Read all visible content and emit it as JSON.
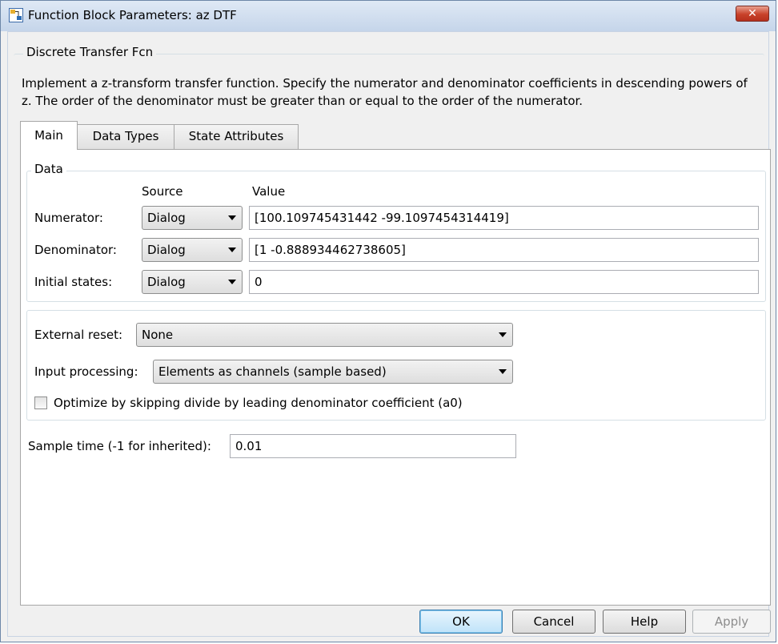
{
  "window": {
    "title": "Function Block Parameters: az DTF",
    "close_glyph": "✕"
  },
  "block": {
    "group_title": "Discrete Transfer Fcn",
    "description": "Implement a z-transform transfer function. Specify the numerator and denominator coefficients in descending powers of z. The order of the denominator must be greater than or equal to the order of the numerator."
  },
  "tabs": [
    {
      "label": "Main",
      "active": true
    },
    {
      "label": "Data Types",
      "active": false
    },
    {
      "label": "State Attributes",
      "active": false
    }
  ],
  "data_group": {
    "title": "Data",
    "source_header": "Source",
    "value_header": "Value",
    "rows": [
      {
        "label": "Numerator:",
        "source": "Dialog",
        "value": "[100.109745431442 -99.1097454314419]"
      },
      {
        "label": "Denominator:",
        "source": "Dialog",
        "value": "[1 -0.888934462738605]"
      },
      {
        "label": "Initial states:",
        "source": "Dialog",
        "value": "0"
      }
    ]
  },
  "options": {
    "external_reset_label": "External reset:",
    "external_reset_value": "None",
    "input_processing_label": "Input processing:",
    "input_processing_value": "Elements as channels (sample based)",
    "optimize_label": "Optimize by skipping divide by leading denominator coefficient (a0)",
    "optimize_checked": false
  },
  "sample_time": {
    "label": "Sample time (-1 for inherited):",
    "value": "0.01"
  },
  "buttons": {
    "ok": "OK",
    "cancel": "Cancel",
    "help": "Help",
    "apply": "Apply"
  },
  "colors": {
    "title_bar": "#cfdcee",
    "close_button": "#c8412a",
    "default_button": "#bfe3f9"
  }
}
